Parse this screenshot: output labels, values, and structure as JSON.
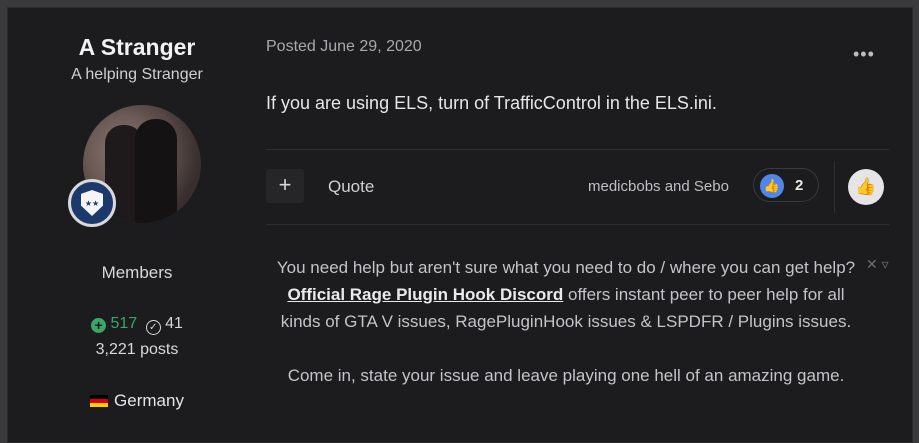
{
  "author": {
    "name": "A Stranger",
    "title": "A helping Stranger",
    "group": "Members",
    "reputation": "517",
    "solutions": "41",
    "posts": "3,221 posts",
    "country": "Germany",
    "badge_icon": "police-shield-icon"
  },
  "post": {
    "date": "Posted June 29, 2020",
    "body": "If you are using ELS, turn of TrafficControl in the ELS.ini.",
    "more_icon": "ellipsis-icon"
  },
  "actions": {
    "plus_label": "+",
    "quote_label": "Quote",
    "likers": "medicbobs and Sebo",
    "like_count": "2",
    "like_color": "#4f86e8"
  },
  "notice": {
    "line1": "You need help but aren't sure what you need to do / where you can get help?",
    "link": "Official Rage Plugin Hook Discord",
    "line2": " offers instant peer to peer help for all kinds of GTA V issues, RagePluginHook issues & LSPDFR / Plugins issues.",
    "line3": "Come in, state your issue and leave playing one hell of an amazing game.",
    "close_label": "✕",
    "collapse_label": "▿"
  }
}
